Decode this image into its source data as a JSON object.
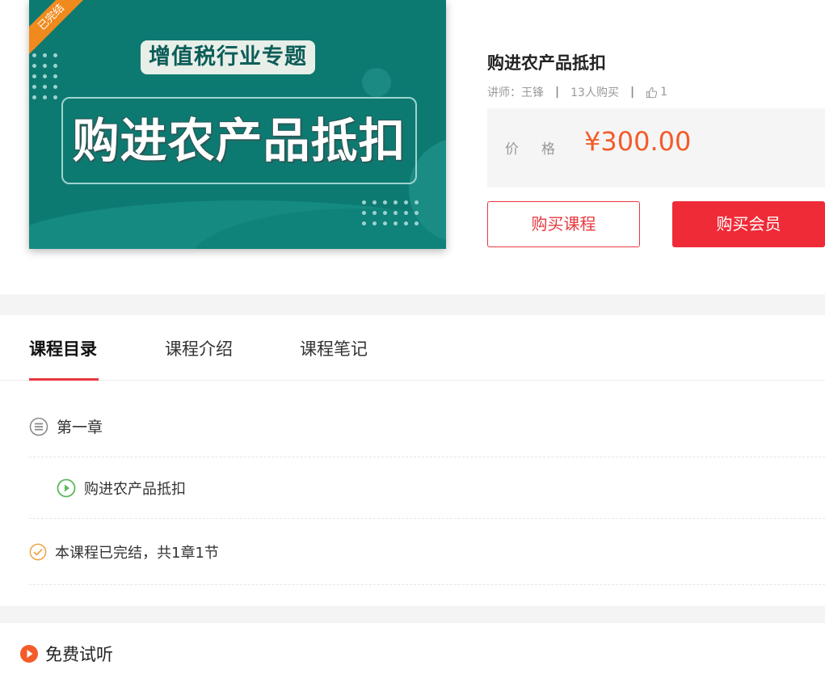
{
  "cover": {
    "badge": "已完结",
    "subtitle": "增值税行业专题",
    "headline": "购进农产品抵扣"
  },
  "course": {
    "title": "购进农产品抵扣",
    "teacher_label": "讲师：王锋",
    "purchases": "13人购买",
    "likes": "1",
    "price_label": "价格",
    "price": "¥300.00",
    "buy_course_label": "购买课程",
    "buy_member_label": "购买会员"
  },
  "tabs": [
    {
      "label": "课程目录",
      "active": true
    },
    {
      "label": "课程介绍",
      "active": false
    },
    {
      "label": "课程笔记",
      "active": false
    }
  ],
  "catalog": {
    "chapter": "第一章",
    "lesson": "购进农产品抵扣",
    "status": "本课程已完结，共1章1节"
  },
  "free_trial": {
    "title": "免费试听"
  },
  "colors": {
    "accent_red": "#ef2b37",
    "price_orange": "#f35b2a",
    "cover_teal": "#0d7a72",
    "play_green": "#5bb85b",
    "check_orange": "#f0a040"
  },
  "icons": {
    "chapter": "list-circle-icon",
    "lesson": "play-circle-icon",
    "done": "check-circle-icon",
    "free": "play-badge-icon",
    "like": "thumbs-up-icon"
  }
}
